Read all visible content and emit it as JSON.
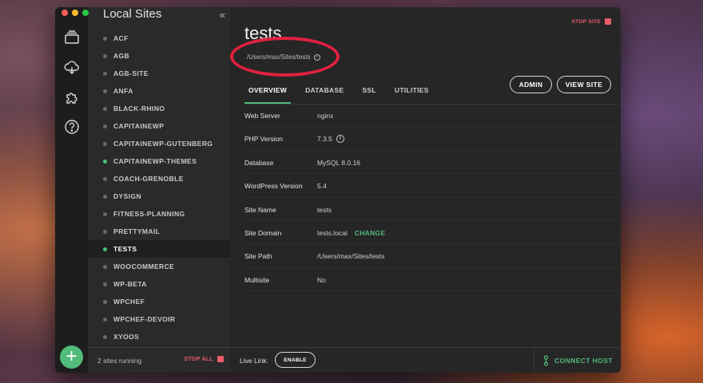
{
  "sidebar": {
    "title": "Local Sites",
    "collapse_icon": "«",
    "sites": [
      {
        "name": "ACF",
        "running": false,
        "active": false
      },
      {
        "name": "AGB",
        "running": false,
        "active": false
      },
      {
        "name": "AGB-SITE",
        "running": false,
        "active": false
      },
      {
        "name": "ANFA",
        "running": false,
        "active": false
      },
      {
        "name": "BLACK-RHINO",
        "running": false,
        "active": false
      },
      {
        "name": "CAPITAINEWP",
        "running": false,
        "active": false
      },
      {
        "name": "CAPITAINEWP-GUTENBERG",
        "running": false,
        "active": false
      },
      {
        "name": "CAPITAINEWP-THEMES",
        "running": true,
        "active": false
      },
      {
        "name": "COACH-GRENOBLE",
        "running": false,
        "active": false
      },
      {
        "name": "DYSIGN",
        "running": false,
        "active": false
      },
      {
        "name": "FITNESS-PLANNING",
        "running": false,
        "active": false
      },
      {
        "name": "PRETTYMAIL",
        "running": false,
        "active": false
      },
      {
        "name": "TESTS",
        "running": true,
        "active": true
      },
      {
        "name": "WOOCOMMERCE",
        "running": false,
        "active": false
      },
      {
        "name": "WP-BETA",
        "running": false,
        "active": false
      },
      {
        "name": "WPCHEF",
        "running": false,
        "active": false
      },
      {
        "name": "WPCHEF-DEVOIR",
        "running": false,
        "active": false
      },
      {
        "name": "XYOOS",
        "running": false,
        "active": false
      }
    ],
    "footer": {
      "running_count": "2 sites running",
      "stop_all_label": "STOP ALL"
    }
  },
  "rail": {
    "icons": [
      "sites-icon",
      "cloud-icon",
      "addons-icon",
      "help-icon"
    ],
    "add_label": "+"
  },
  "main": {
    "stop_site_label": "STOP SITE",
    "site_title": "tests",
    "site_path": "/Users/max/Sites/tests",
    "tabs": [
      {
        "label": "OVERVIEW",
        "active": true
      },
      {
        "label": "DATABASE",
        "active": false
      },
      {
        "label": "SSL",
        "active": false
      },
      {
        "label": "UTILITIES",
        "active": false
      }
    ],
    "admin_label": "ADMIN",
    "view_site_label": "VIEW SITE",
    "details": [
      {
        "label": "Web Server",
        "value": "nginx"
      },
      {
        "label": "PHP Version",
        "value": "7.3.5",
        "info": true
      },
      {
        "label": "Database",
        "value": "MySQL 8.0.16"
      },
      {
        "label": "WordPress Version",
        "value": "5.4"
      },
      {
        "label": "Site Name",
        "value": "tests"
      },
      {
        "label": "Site Domain",
        "value": "tests.local",
        "link": "CHANGE"
      },
      {
        "label": "Site Path",
        "value": "/Users/max/Sites/tests"
      },
      {
        "label": "Multisite",
        "value": "No"
      }
    ],
    "footer": {
      "live_link_label": "Live Link:",
      "enable_label": "ENABLE",
      "connect_host_label": "CONNECT HOST"
    }
  },
  "colors": {
    "accent": "#51bb7b",
    "danger": "#e85d6a",
    "highlight_ring": "#e0213f"
  }
}
